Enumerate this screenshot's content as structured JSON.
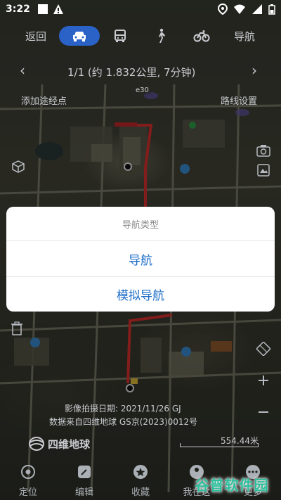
{
  "status_bar": {
    "time": "3:22",
    "icons": [
      "gallery-icon",
      "warning-icon",
      "location-icon",
      "wifi-icon",
      "signal-icon",
      "battery-icon"
    ]
  },
  "mode_bar": {
    "back_label": "返回",
    "tabs": [
      {
        "name": "car",
        "icon": "car-icon",
        "active": true
      },
      {
        "name": "bus",
        "icon": "bus-icon",
        "active": false
      },
      {
        "name": "walk",
        "icon": "walk-icon",
        "active": false
      },
      {
        "name": "bike",
        "icon": "bike-icon",
        "active": false
      }
    ],
    "nav_label": "导航"
  },
  "route": {
    "summary": "1/1  (约 1.832公里, 7分钟)",
    "add_waypoint": "添加途经点",
    "route_settings": "路线设置"
  },
  "map_info": {
    "image_date": "影像拍摄日期: 2021/11/26 GJ",
    "data_source": "数据来自四维地球 GS京(2023)0012号",
    "brand": "四维地球",
    "scale": "554.44米",
    "road_label": "e30"
  },
  "bottom_nav": {
    "items": [
      {
        "label": "定位",
        "icon": "locate-icon"
      },
      {
        "label": "编辑",
        "icon": "edit-icon"
      },
      {
        "label": "收藏",
        "icon": "star-icon"
      },
      {
        "label": "我在这",
        "icon": "person-pin-icon"
      },
      {
        "label": "更多",
        "icon": "more-icon"
      }
    ]
  },
  "dialog": {
    "title": "导航类型",
    "options": [
      "导航",
      "模拟导航"
    ]
  },
  "watermark": "谷普软件园",
  "colors": {
    "accent": "#2b62c8",
    "dialog_option": "#1b6cc6",
    "route": "#e0322f"
  }
}
